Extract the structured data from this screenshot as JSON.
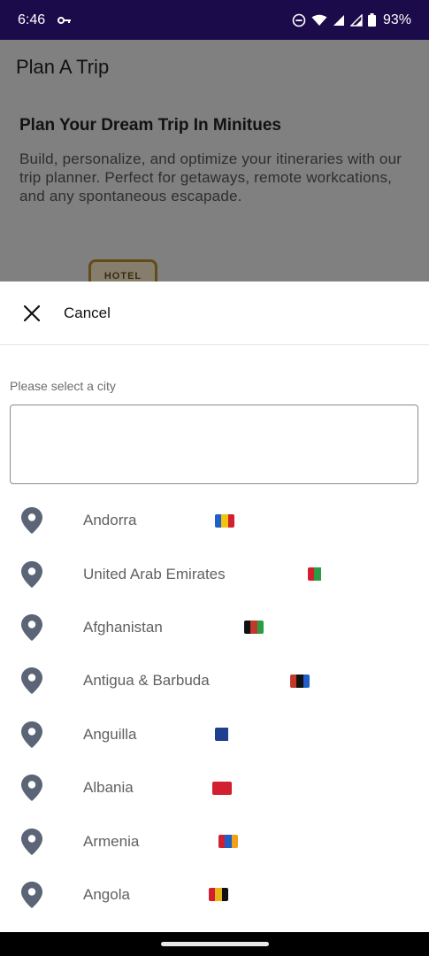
{
  "status_bar": {
    "time": "6:46",
    "battery": "93%"
  },
  "background_app": {
    "title": "Plan A Trip",
    "heading": "Plan Your Dream Trip In Minitues",
    "description": "Build, personalize, and optimize your itineraries with our trip planner. Perfect for getaways, remote workcations, and any spontaneous escapade.",
    "illustration_text": "HOTEL"
  },
  "sheet": {
    "cancel_label": "Cancel",
    "field_label": "Please select a city",
    "input_value": "",
    "cities": [
      {
        "name": "Andorra",
        "flag_colors": [
          "#1f5fc8",
          "#f1c40f",
          "#d3202f"
        ]
      },
      {
        "name": "United Arab Emirates",
        "flag_colors": [
          "#d3202f",
          "#2a9d44",
          "#ffffff"
        ]
      },
      {
        "name": "Afghanistan",
        "flag_colors": [
          "#111111",
          "#c0392b",
          "#2a9d44"
        ]
      },
      {
        "name": "Antigua & Barbuda",
        "flag_colors": [
          "#c0392b",
          "#111111",
          "#1f5fc8"
        ]
      },
      {
        "name": "Anguilla",
        "flag_colors": [
          "#1f3f8f",
          "#1f3f8f",
          "#ffffff"
        ]
      },
      {
        "name": "Albania",
        "flag_colors": [
          "#d3202f",
          "#d3202f",
          "#d3202f"
        ]
      },
      {
        "name": "Armenia",
        "flag_colors": [
          "#d3202f",
          "#1f5fc8",
          "#f0a21a"
        ]
      },
      {
        "name": "Angola",
        "flag_colors": [
          "#d3202f",
          "#e8b517",
          "#111111"
        ]
      }
    ]
  },
  "colors": {
    "status_bar": "#1c0b4a",
    "pin": "#5c6478",
    "city_text": "#616161"
  },
  "icons": {
    "close": "close-icon",
    "pin": "location-pin-icon",
    "key": "key-icon",
    "wifi": "wifi-icon",
    "signal": "signal-icon",
    "battery": "battery-icon",
    "dnd": "do-not-disturb-icon"
  }
}
